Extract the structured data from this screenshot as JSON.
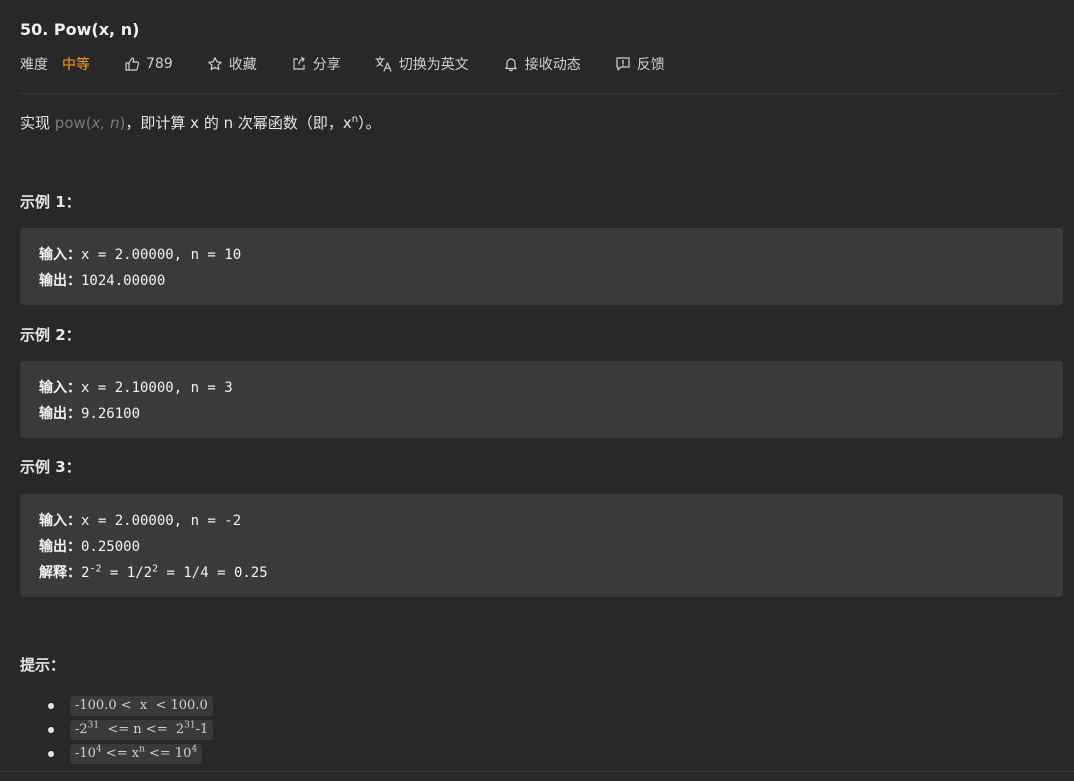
{
  "problem": {
    "title": "50. Pow(x, n)"
  },
  "meta": {
    "difficulty_label": "难度",
    "difficulty": "中等",
    "likes": "789",
    "favorite": "收藏",
    "share": "分享",
    "switch_lang": "切换为英文",
    "subscribe": "接收动态",
    "feedback": "反馈",
    "colors": {
      "difficulty": "#ffa116"
    }
  },
  "description": {
    "prefix": "实现",
    "func_name": "pow(",
    "func_args": "x, n",
    "func_close": ")",
    "middle": "，即计算 x 的 n 次幂函数（即，x",
    "sup": "n",
    "suffix": "）。"
  },
  "examples": [
    {
      "title": "示例 1：",
      "input_label": "输入：",
      "input": "x = 2.00000, n = 10",
      "output_label": "输出：",
      "output": "1024.00000"
    },
    {
      "title": "示例 2：",
      "input_label": "输入：",
      "input": "x = 2.10000, n = 3",
      "output_label": "输出：",
      "output": "9.26100"
    },
    {
      "title": "示例 3：",
      "input_label": "输入：",
      "input": "x = 2.00000, n = -2",
      "output_label": "输出：",
      "output": "0.25000",
      "explain_label": "解释：",
      "explain_base": "2",
      "explain_exp": "-2",
      "explain_mid": " = 1/2",
      "explain_exp2": "2",
      "explain_end": " = 1/4 = 0.25"
    }
  ],
  "hints": {
    "title": "提示：",
    "h1": "-100.0 <  x  < 100.0",
    "h2_a": "-2",
    "h2_b": "31",
    "h2_c": "  <= n <=  2",
    "h2_d": "31",
    "h2_e": "-1",
    "h3_a": "-10",
    "h3_b": "4",
    "h3_c": " <= x",
    "h3_d": "n",
    "h3_e": " <= 10",
    "h3_f": "4"
  }
}
